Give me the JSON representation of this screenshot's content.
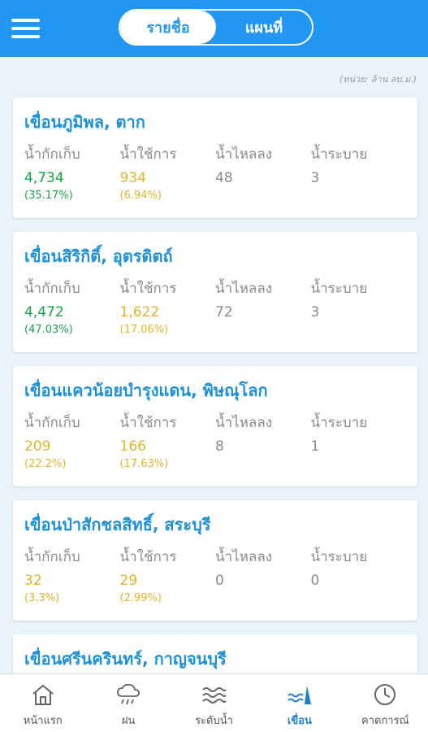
{
  "header": {
    "segments": [
      {
        "label": "รายชื่อ",
        "active": true
      },
      {
        "label": "แผนที่",
        "active": false
      }
    ]
  },
  "unit_note": "(หน่วย: ล้าน ลบ.ม.)",
  "column_labels": {
    "storage": "น้ำกักเก็บ",
    "usable": "น้ำใช้การ",
    "inflow": "น้ำไหลลง",
    "outflow": "น้ำระบาย"
  },
  "dams": [
    {
      "name": "เขื่อนภูมิพล, ตาก",
      "storage": "4,734",
      "storage_pct": "(35.17%)",
      "usable": "934",
      "usable_pct": "(6.94%)",
      "inflow": "48",
      "outflow": "3",
      "storage_color": "#1aa34a",
      "usable_color": "#e0b626"
    },
    {
      "name": "เขื่อนสิริกิติ์, อุตรดิตถ์",
      "storage": "4,472",
      "storage_pct": "(47.03%)",
      "usable": "1,622",
      "usable_pct": "(17.06%)",
      "inflow": "72",
      "outflow": "3",
      "storage_color": "#1aa34a",
      "usable_color": "#e0b626"
    },
    {
      "name": "เขื่อนแควน้อยบำรุงแดน, พิษณุโลก",
      "storage": "209",
      "storage_pct": "(22.2%)",
      "usable": "166",
      "usable_pct": "(17.63%)",
      "inflow": "8",
      "outflow": "1",
      "storage_color": "#e0b626",
      "usable_color": "#e0b626"
    },
    {
      "name": "เขื่อนป่าสักชลสิทธิ์, สระบุรี",
      "storage": "32",
      "storage_pct": "(3.3%)",
      "usable": "29",
      "usable_pct": "(2.99%)",
      "inflow": "0",
      "outflow": "0",
      "storage_color": "#e0b626",
      "usable_color": "#e0b626"
    },
    {
      "name": "เขื่อนศรีนครินทร์, กาญจนบุรี"
    }
  ],
  "tabs": [
    {
      "label": "หน้าแรก",
      "icon": "home-icon",
      "active": false
    },
    {
      "label": "ฝน",
      "icon": "rain-cloud-icon",
      "active": false
    },
    {
      "label": "ระดับน้ำ",
      "icon": "water-waves-icon",
      "active": false
    },
    {
      "label": "เขื่อน",
      "icon": "dam-icon",
      "active": true
    },
    {
      "label": "คาดการณ์",
      "icon": "clock-icon",
      "active": false
    }
  ],
  "colors": {
    "primary": "#2196f3",
    "title": "#1e90d8",
    "green": "#1aa34a",
    "yellow": "#e0b626"
  }
}
